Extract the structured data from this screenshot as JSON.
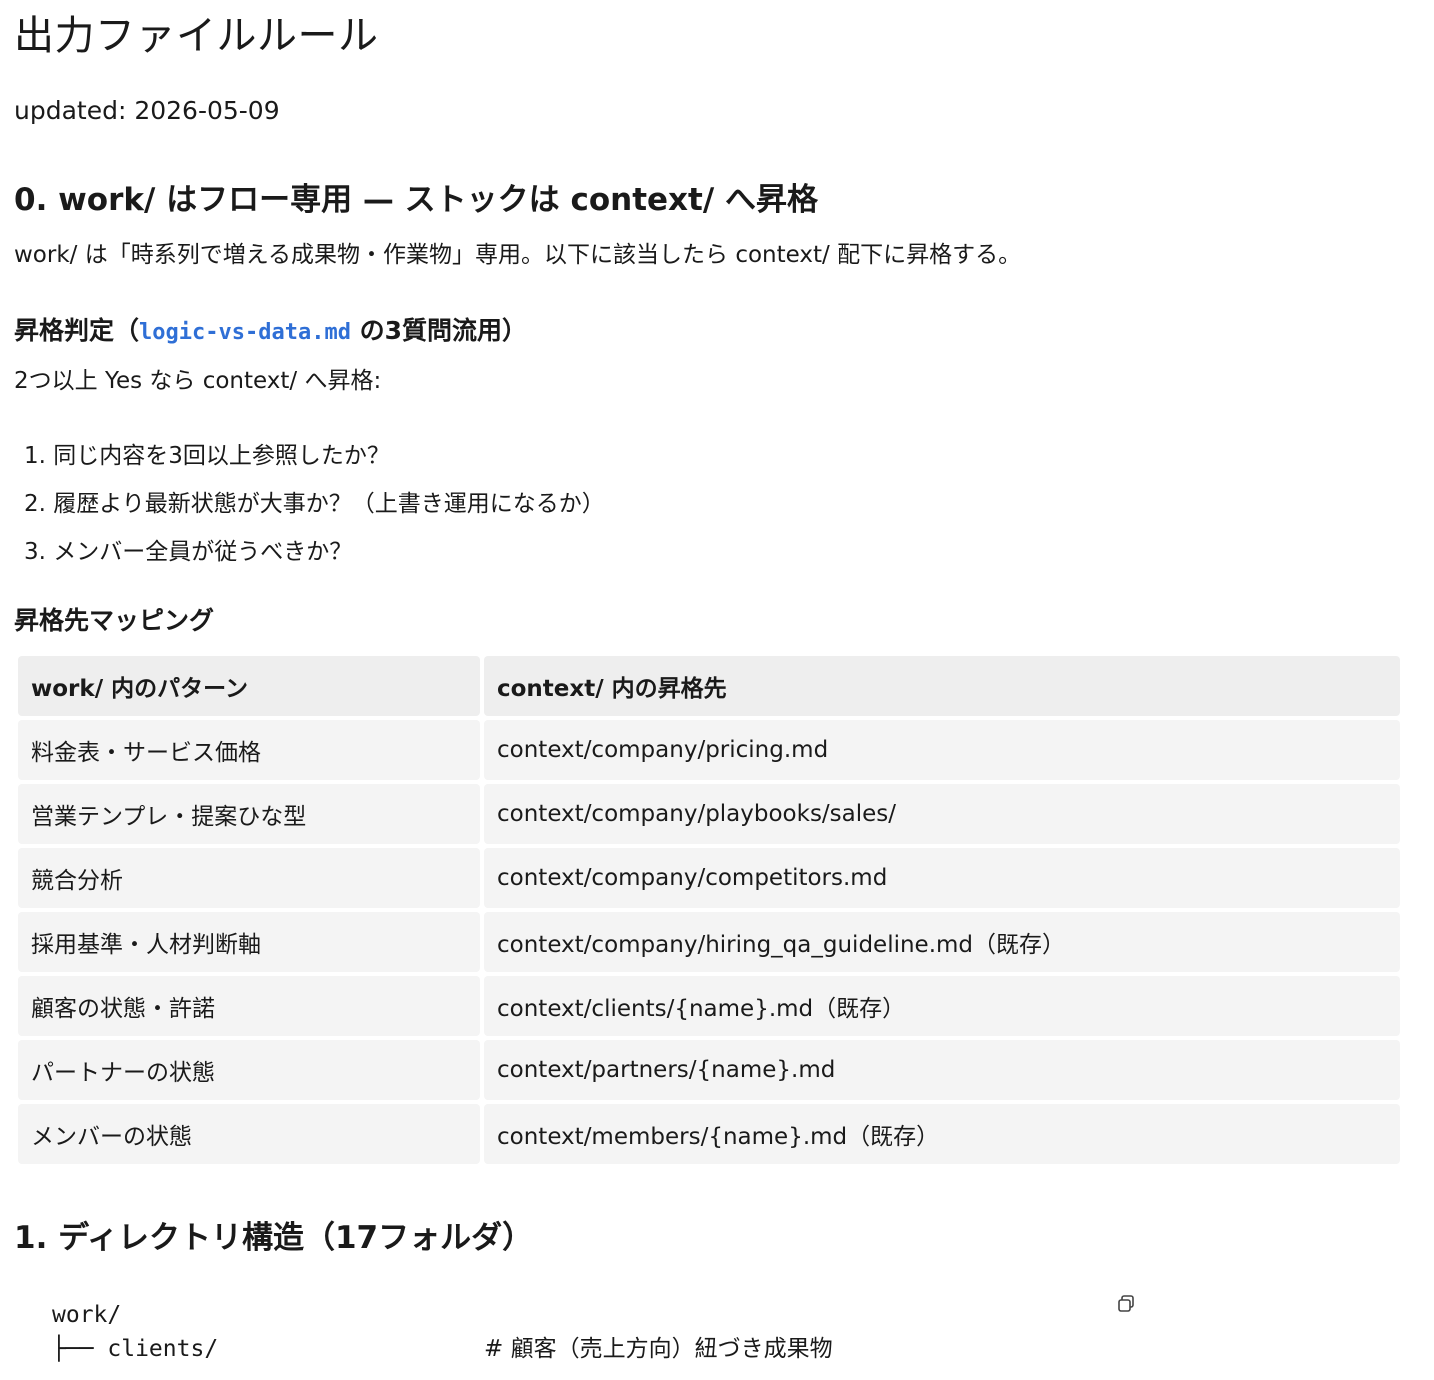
{
  "title": "出力ファイルルール",
  "updated": "updated: 2026-05-09",
  "section0": {
    "heading": "0. work/ はフロー専用 — ストックは context/ へ昇格",
    "intro": "work/ は「時系列で増える成果物・作業物」専用。以下に該当したら context/ 配下に昇格する。",
    "judge": {
      "heading_prefix": "昇格判定（",
      "heading_code": "logic-vs-data.md",
      "heading_suffix": " の3質問流用）",
      "rule": "2つ以上 Yes なら context/ へ昇格:",
      "questions": [
        "1. 同じ内容を3回以上参照したか？",
        "2. 履歴より最新状態が大事か？（上書き運用になるか）",
        "3. メンバー全員が従うべきか？"
      ]
    },
    "mapping": {
      "heading": "昇格先マッピング",
      "columns": [
        "work/ 内のパターン",
        "context/ 内の昇格先"
      ],
      "rows": [
        [
          "料金表・サービス価格",
          "context/company/pricing.md"
        ],
        [
          "営業テンプレ・提案ひな型",
          "context/company/playbooks/sales/"
        ],
        [
          "競合分析",
          "context/company/competitors.md"
        ],
        [
          "採用基準・人材判断軸",
          "context/company/hiring_qa_guideline.md（既存）"
        ],
        [
          "顧客の状態・許諾",
          "context/clients/{name}.md（既存）"
        ],
        [
          "パートナーの状態",
          "context/partners/{name}.md"
        ],
        [
          "メンバーの状態",
          "context/members/{name}.md（既存）"
        ]
      ]
    }
  },
  "section1": {
    "heading": "1. ディレクトリ構造（17フォルダ）",
    "code": {
      "line1": "work/",
      "line2": "├── clients/",
      "line2_comment": "#  顧客（売上方向）紐づき成果物",
      "copy_icon": "copy-icon"
    }
  }
}
